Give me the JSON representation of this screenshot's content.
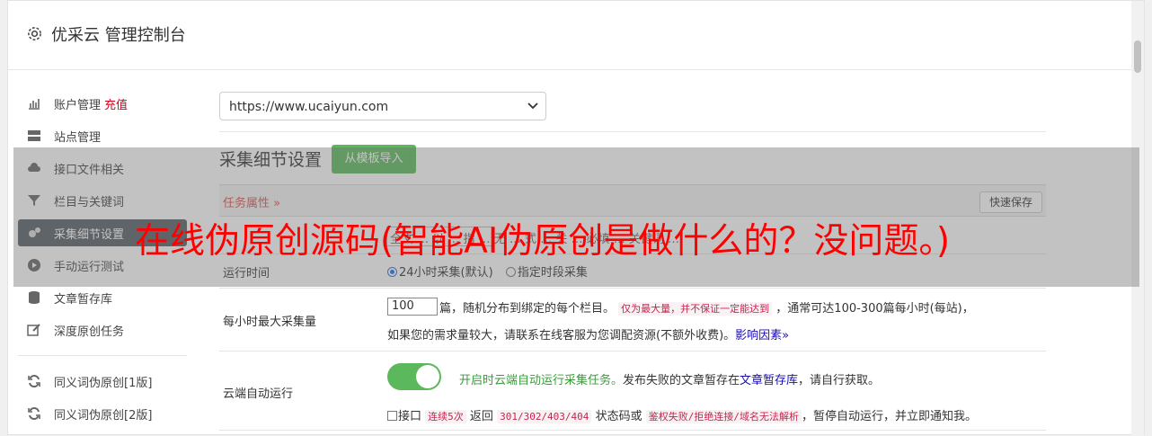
{
  "header": {
    "title": "优采云 管理控制台",
    "icon": "gear-icon"
  },
  "sidebar": {
    "items": [
      {
        "label": "账户管理",
        "extra": "充值",
        "icon": "bar-chart-icon"
      },
      {
        "label": "站点管理",
        "icon": "server-icon"
      },
      {
        "label": "接口文件相关",
        "icon": "cloud-upload-icon"
      },
      {
        "label": "栏目与关键词",
        "icon": "filter-icon"
      },
      {
        "label": "采集细节设置",
        "icon": "cogs-icon",
        "active": true
      },
      {
        "label": "手动运行测试",
        "icon": "play-circle-icon"
      },
      {
        "label": "文章暂存库",
        "icon": "database-icon"
      },
      {
        "label": "深度原创任务",
        "icon": "edit-icon"
      },
      {
        "label": "同义词伪原创[1版]",
        "icon": "refresh-icon"
      },
      {
        "label": "同义词伪原创[2版]",
        "icon": "refresh-icon"
      }
    ]
  },
  "main": {
    "site_select": {
      "value": "https://www.ucaiyun.com"
    },
    "section_title": "采集细节设置",
    "template_button": "从模板导入",
    "task_attr": "任务属性 »",
    "quick_save": "快速保存",
    "faded_row_text": "全文 … 以 … 指 … 无 … 式 … 关 … 必填 … 关键词 …",
    "run_time": {
      "label": "运行时间",
      "option1": "24小时采集(默认)",
      "option2": "指定时段采集"
    },
    "max_per_hour": {
      "label": "每小时最大采集量",
      "value": "100",
      "text1": "篇，随机分布到绑定的每个栏目。",
      "highlight": "仅为最大量，并不保证一定能达到",
      "text2": "，通常可达100-300篇每小时(每站)，",
      "line2": "如果您的需求量较大，请联系在线客服为您调配资源(不额外收费)。",
      "link": "影响因素"
    },
    "cloud_run": {
      "label": "云端自动运行",
      "enabled_text": "开启时云端自动运行采集任务。",
      "text_mid": "发布失败的文章暂存在",
      "link": "文章暂存库",
      "text_end": "，请自行获取。",
      "line2_prefix": "接口",
      "code1": "连续5次",
      "text_a": "返回",
      "code2": "301/302/403/404",
      "text_b": "状态码或",
      "code3": "鉴权失败/拒绝连接/域名无法解析",
      "text_c": "，暂停自动运行，并立即通知我。"
    }
  },
  "overlay": {
    "text": "在线伪原创源码(智能AI伪原创是做什么的？没问题。)"
  },
  "colors": {
    "accent_green": "#5cb85c",
    "overlay_red": "#ff0000",
    "active_bg": "#555d66"
  }
}
